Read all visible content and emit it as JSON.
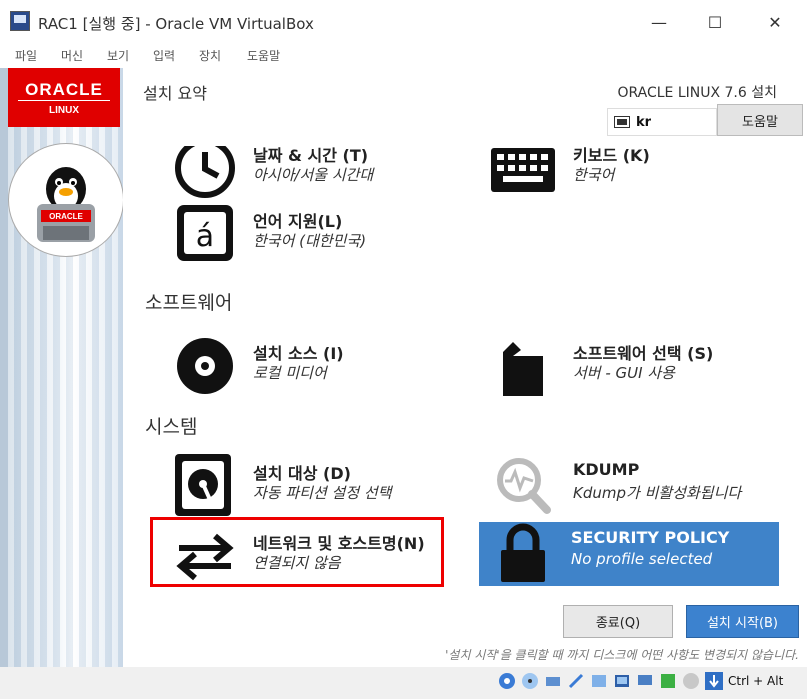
{
  "window": {
    "title": "RAC1 [실행 중] - Oracle VM VirtualBox",
    "minimize": "—",
    "maximize": "☐",
    "close": "✕"
  },
  "menubar": [
    "파일",
    "머신",
    "보기",
    "입력",
    "장치",
    "도움말"
  ],
  "sidebar": {
    "logo_word": "ORACLE",
    "logo_sub": "LINUX"
  },
  "header": {
    "title": "설치 요약",
    "product": "ORACLE LINUX 7.6 설치",
    "keyboard_layout": "kr",
    "help_label": "도움말"
  },
  "sections": {
    "software": "소프트웨어",
    "system": "시스템"
  },
  "spokes": {
    "datetime": {
      "title": "날짜 & 시간 (T)",
      "status": "아시아/서울 시간대"
    },
    "keyboard": {
      "title": "키보드 (K)",
      "status": "한국어"
    },
    "language": {
      "title": "언어 지원(L)",
      "status": "한국어 (대한민국)"
    },
    "source": {
      "title": "설치 소스 (I)",
      "status": "로컬 미디어"
    },
    "software": {
      "title": "소프트웨어 선택 (S)",
      "status": "서버 - GUI 사용"
    },
    "destination": {
      "title": "설치 대상 (D)",
      "status": "자동 파티션 설정 선택"
    },
    "kdump": {
      "title": "KDUMP",
      "status": "Kdump가 비활성화됩니다"
    },
    "network": {
      "title": "네트워크 및 호스트명(N)",
      "status": "연결되지 않음"
    },
    "security": {
      "title": "SECURITY POLICY",
      "status": "No profile selected"
    }
  },
  "buttons": {
    "quit": "종료(Q)",
    "begin": "설치 시작(B)"
  },
  "notice": "'설치 시작'을 클릭할 때 까지 디스크에 어떤 사항도 변경되지 않습니다.",
  "statusbar": {
    "host_key": "Ctrl + Alt"
  },
  "colors": {
    "accent_blue": "#3f83c9",
    "highlight_red": "#ee0000",
    "oracle_red": "#e00000"
  }
}
